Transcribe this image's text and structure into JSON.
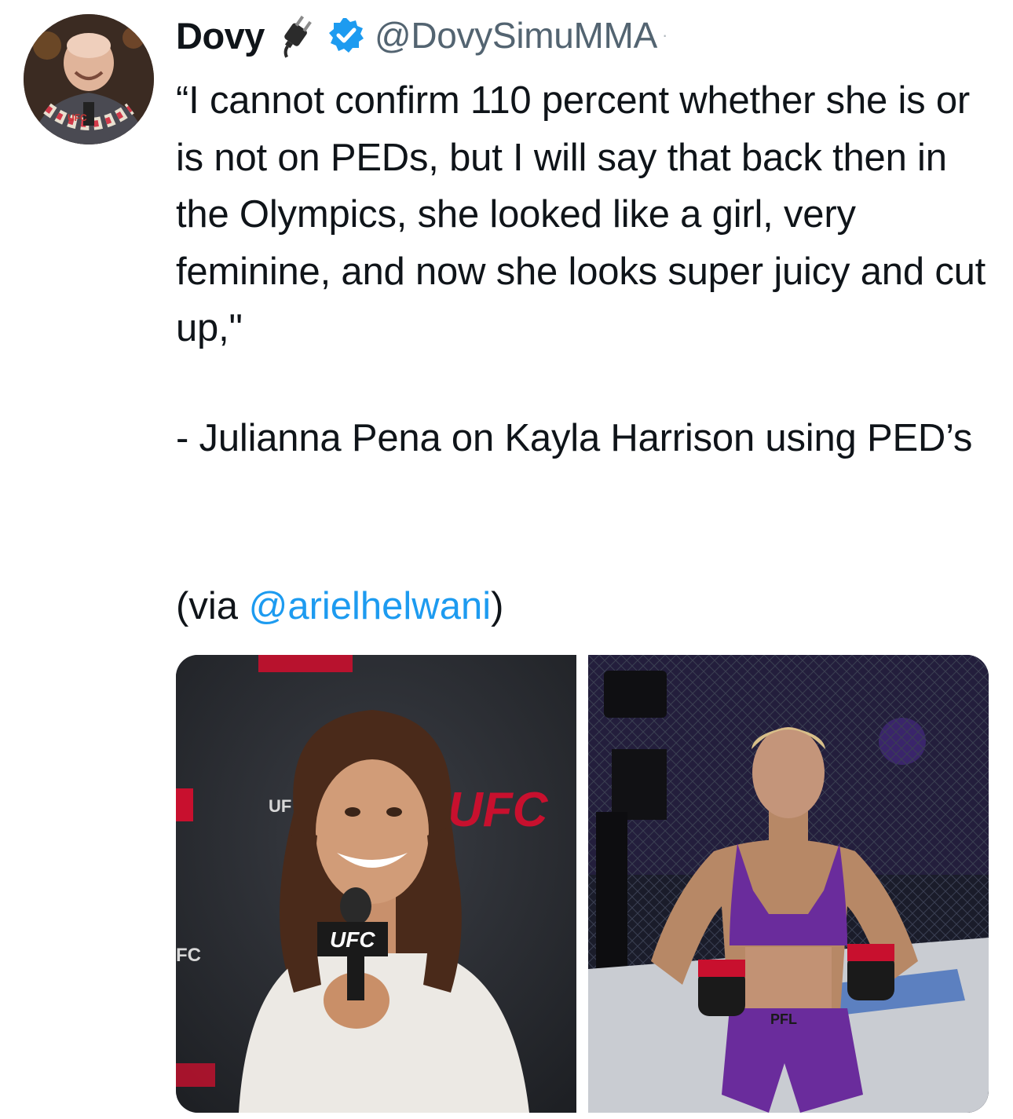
{
  "tweet": {
    "display_name": "Dovy",
    "handle": "@DovySimuMMA",
    "handle_separator": "·",
    "avatar_icon": "profile-photo",
    "plug_icon": "electric-plug-icon",
    "verified_icon": "verified-badge-icon",
    "text": "“I cannot confirm 110 percent whether she is or is not on PEDs, but I will say that back then in the Olympics, she looked like a girl, very feminine, and now she looks super juicy and cut up,\"",
    "attribution": "- Julianna Pena on Kayla Harrison using PED’s",
    "via_prefix": "(via ",
    "via_mention": "@arielhelwani",
    "via_suffix": ")",
    "colors": {
      "text": "#0f1419",
      "handle": "#536471",
      "mention": "#1d9bf0",
      "verified": "#1d9bf0"
    }
  },
  "media": {
    "left_image": {
      "banner_text": "UFC",
      "mic_flag_text": "UFC",
      "side_text_left": "FC",
      "backdrop_small": "UF"
    },
    "right_image": {
      "shorts_text": "PFL"
    },
    "mute_icon": "muted-speaker-icon"
  }
}
